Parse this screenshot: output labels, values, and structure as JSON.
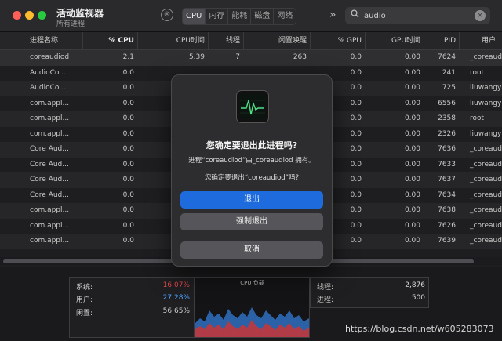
{
  "app": {
    "title": "活动监视器",
    "subtitle": "所有进程"
  },
  "toolbar": {
    "stop_glyph": "⊗",
    "tabs": [
      "CPU",
      "内存",
      "能耗",
      "磁盘",
      "网络"
    ],
    "more_glyph": "»",
    "search": {
      "value": "audio",
      "placeholder": "搜索",
      "clear_glyph": "×"
    }
  },
  "table": {
    "columns": [
      "进程名称",
      "% CPU",
      "CPU时间",
      "线程",
      "闲置唤醒",
      "% GPU",
      "GPU时间",
      "PID",
      "用户"
    ],
    "rows": [
      [
        "coreaudiod",
        "2.1",
        "5.39",
        "7",
        "263",
        "0.0",
        "0.00",
        "7624",
        "_coreaudiod"
      ],
      [
        "AudioCo...",
        "0.0",
        "",
        "",
        "",
        "0.0",
        "0.00",
        "241",
        "root"
      ],
      [
        "AudioCo...",
        "0.0",
        "",
        "",
        "",
        "0.0",
        "0.00",
        "725",
        "liuwangyang"
      ],
      [
        "com.appl...",
        "0.0",
        "",
        "",
        "",
        "0.0",
        "0.00",
        "6556",
        "liuwangyang"
      ],
      [
        "com.appl...",
        "0.0",
        "",
        "",
        "",
        "0.0",
        "0.00",
        "2358",
        "root"
      ],
      [
        "com.appl...",
        "0.0",
        "",
        "",
        "",
        "0.0",
        "0.00",
        "2326",
        "liuwangyang"
      ],
      [
        "Core Aud...",
        "0.0",
        "",
        "",
        "",
        "0.0",
        "0.00",
        "7636",
        "_coreaudiod"
      ],
      [
        "Core Aud...",
        "0.0",
        "",
        "",
        "",
        "0.0",
        "0.00",
        "7633",
        "_coreaudiod"
      ],
      [
        "Core Aud...",
        "0.0",
        "",
        "",
        "",
        "0.0",
        "0.00",
        "7637",
        "_coreaudiod"
      ],
      [
        "Core Aud...",
        "0.0",
        "",
        "",
        "",
        "0.0",
        "0.00",
        "7634",
        "_coreaudiod"
      ],
      [
        "com.appl...",
        "0.0",
        "",
        "",
        "",
        "0.0",
        "0.00",
        "7638",
        "_coreaudiod"
      ],
      [
        "com.appl...",
        "0.0",
        "",
        "",
        "",
        "0.0",
        "0.00",
        "7626",
        "_coreaudiod"
      ],
      [
        "com.appl...",
        "0.0",
        "",
        "",
        "",
        "0.0",
        "0.00",
        "7639",
        "_coreaudiod"
      ]
    ]
  },
  "summary": {
    "system_label": "系统:",
    "system_value": "16.07%",
    "user_label": "用户:",
    "user_value": "27.28%",
    "idle_label": "闲置:",
    "idle_value": "56.65%",
    "graph_title": "CPU 负载",
    "threads_label": "线程:",
    "threads_value": "2,876",
    "processes_label": "进程:",
    "processes_value": "500"
  },
  "dialog": {
    "title": "您确定要退出此进程吗?",
    "message1": "进程“coreaudiod”由_coreaudiod 拥有。",
    "message2": "您确定要退出“coreaudiod”吗?",
    "quit_label": "退出",
    "force_quit_label": "强制退出",
    "cancel_label": "取消"
  },
  "watermark": "https://blog.csdn.net/w605283073",
  "colors": {
    "accent": "#1d6bdc",
    "system_value": "#e0474c",
    "user_value": "#4aa3ff",
    "idle_value": "#cfcfcf",
    "graph_user": "#2f6fc0",
    "graph_system": "#c0393d"
  }
}
